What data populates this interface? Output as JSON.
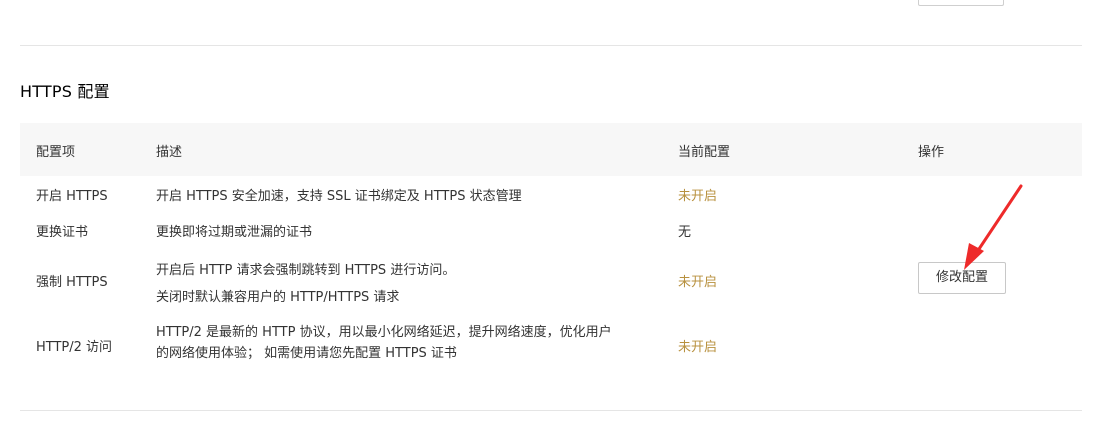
{
  "section": {
    "title": "HTTPS 配置"
  },
  "table": {
    "headers": {
      "item": "配置项",
      "description": "描述",
      "current": "当前配置",
      "action": "操作"
    },
    "rows": [
      {
        "item": "开启 HTTPS",
        "description": [
          "开启 HTTPS 安全加速，支持 SSL 证书绑定及 HTTPS 状态管理"
        ],
        "current": "未开启"
      },
      {
        "item": "更换证书",
        "description": [
          "更换即将过期或泄漏的证书"
        ],
        "current": "无"
      },
      {
        "item": "强制 HTTPS",
        "description": [
          "开启后 HTTP 请求会强制跳转到 HTTPS 进行访问。",
          "关闭时默认兼容用户的 HTTP/HTTPS 请求"
        ],
        "current": "未开启"
      },
      {
        "item": "HTTP/2 访问",
        "description": [
          "HTTP/2 是最新的 HTTP 协议，用以最小化网络延迟，提升网络速度，优化用户",
          "的网络使用体验； 如需使用请您先配置 HTTPS 证书"
        ],
        "current": "未开启"
      }
    ],
    "action_button": "修改配置"
  },
  "colors": {
    "status_off": "#b8913f",
    "header_bg": "#f7f7f7",
    "annotation_arrow": "#ee2a2a"
  }
}
